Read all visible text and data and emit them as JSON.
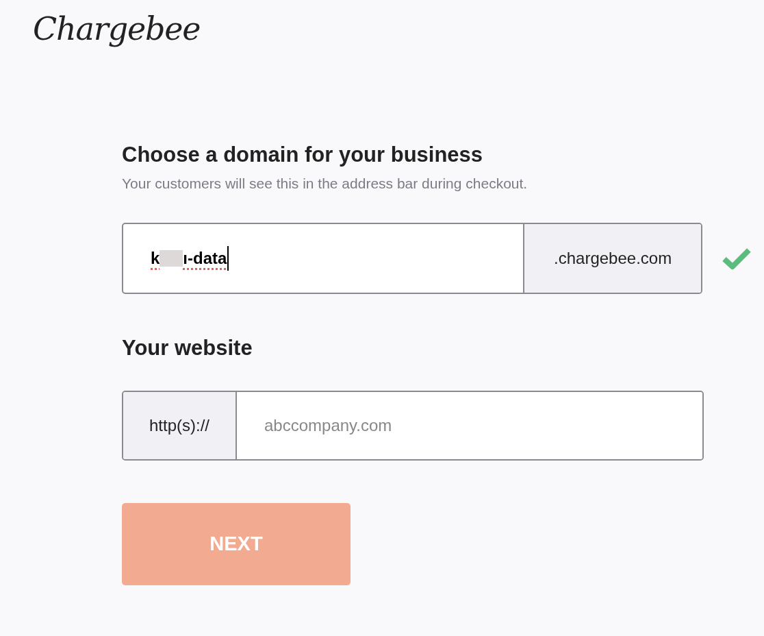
{
  "logo": "Chargebee",
  "domain": {
    "title": "Choose a domain for your business",
    "subtitle": "Your customers will see this in the address bar during checkout.",
    "value_start": "k",
    "value_end": "ı-data",
    "redacted": true,
    "spellcheck_error": true,
    "suffix": ".chargebee.com",
    "valid": true
  },
  "website": {
    "title": "Your website",
    "prefix": "http(s)://",
    "placeholder": "abccompany.com"
  },
  "button": {
    "label": "NEXT",
    "disabled": true
  }
}
